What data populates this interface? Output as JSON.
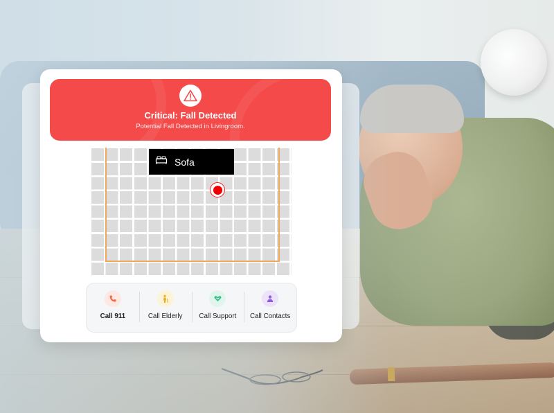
{
  "alert": {
    "title": "Critical: Fall Detected",
    "subtitle": "Potential Fall Detected in Livingroom.",
    "icon": "warning-triangle-icon",
    "color": "#f44a4a"
  },
  "floorplan": {
    "furniture_label": "Sofa",
    "furniture_icon": "bed-icon",
    "marker_color": "#f00000",
    "room_border_color": "#f2a65a"
  },
  "actions": [
    {
      "label": "Call 911",
      "icon": "phone-icon",
      "icon_color": "#f26a4b",
      "icon_bg": "#fde8e3"
    },
    {
      "label": "Call Elderly",
      "icon": "elderly-person-icon",
      "icon_color": "#e3b21a",
      "icon_bg": "#fdf4d7"
    },
    {
      "label": "Call Support",
      "icon": "heart-hands-icon",
      "icon_color": "#3fbf8a",
      "icon_bg": "#e0f6ec"
    },
    {
      "label": "Call Contacts",
      "icon": "person-icon",
      "icon_color": "#8b5fd6",
      "icon_bg": "#ece3fb"
    }
  ]
}
